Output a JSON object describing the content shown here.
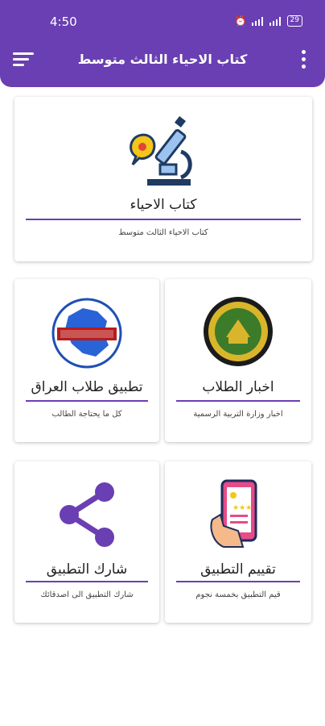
{
  "status_bar": {
    "time": "4:50",
    "battery": "29"
  },
  "app_bar": {
    "title": "كتاب الاحياء الثالث متوسط"
  },
  "cards": {
    "book": {
      "title": "كتاب الاحياء",
      "subtitle": "كتاب الاحياء الثالث متوسط",
      "icon": "microscope-icon"
    },
    "news": {
      "title": "اخبار الطلاب",
      "subtitle": "اخبار وزارة التربية الرسمية",
      "icon": "ministry-seal-icon"
    },
    "iraq_app": {
      "title": "تطبيق طلاب العراق",
      "subtitle": "كل ما يحتاجة الطالب",
      "icon": "iraq-map-logo-icon"
    },
    "rate": {
      "title": "تقييم التطبيق",
      "subtitle": "قيم التطبيق بخمسة نجوم",
      "icon": "phone-rating-icon"
    },
    "share": {
      "title": "شارك التطبيق",
      "subtitle": "شارك التطبيق الى اصدقائك",
      "icon": "share-icon"
    }
  },
  "colors": {
    "primary": "#6a3fb3",
    "accent_yellow": "#f5c518",
    "dark_blue": "#1f3b63"
  }
}
